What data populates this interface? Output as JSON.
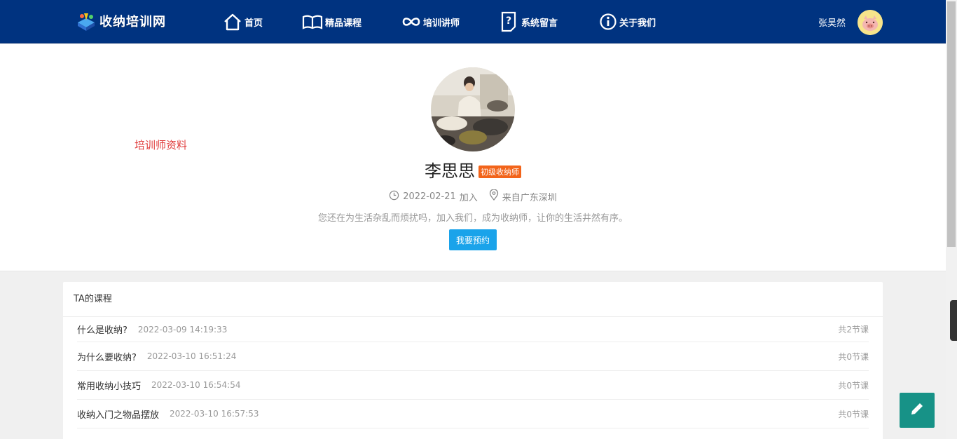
{
  "header": {
    "brand": "收纳培训网",
    "nav": [
      {
        "label": "首页",
        "icon": "home-icon"
      },
      {
        "label": "精品课程",
        "icon": "book-icon"
      },
      {
        "label": "培训讲师",
        "icon": "infinity-icon"
      },
      {
        "label": "系统留言",
        "icon": "question-icon"
      },
      {
        "label": "关于我们",
        "icon": "info-icon"
      }
    ],
    "user_name": "张昊然"
  },
  "profile": {
    "side_label": "培训师资料",
    "name": "李思思",
    "level": "初级收纳师",
    "joined_date": "2022-02-21",
    "joined_suffix": "加入",
    "location": "来自广东深圳",
    "intro": "您还在为生活杂乱而烦扰吗，加入我们，成为收纳师，让你的生活井然有序。",
    "book_button": "我要预约"
  },
  "courses": {
    "title": "TA的课程",
    "items": [
      {
        "title": "什么是收纳?",
        "time": "2022-03-09 14:19:33",
        "count": "共2节课"
      },
      {
        "title": "为什么要收纳?",
        "time": "2022-03-10 16:51:24",
        "count": "共0节课"
      },
      {
        "title": "常用收纳小技巧",
        "time": "2022-03-10 16:54:54",
        "count": "共0节课"
      },
      {
        "title": "收纳入门之物品摆放",
        "time": "2022-03-10 16:57:53",
        "count": "共0节课"
      }
    ]
  },
  "colors": {
    "header_bg": "#003380",
    "accent_blue": "#1aa3ea",
    "badge_orange": "#f2641a",
    "label_red": "#e03c3c",
    "fab_teal": "#179287"
  }
}
